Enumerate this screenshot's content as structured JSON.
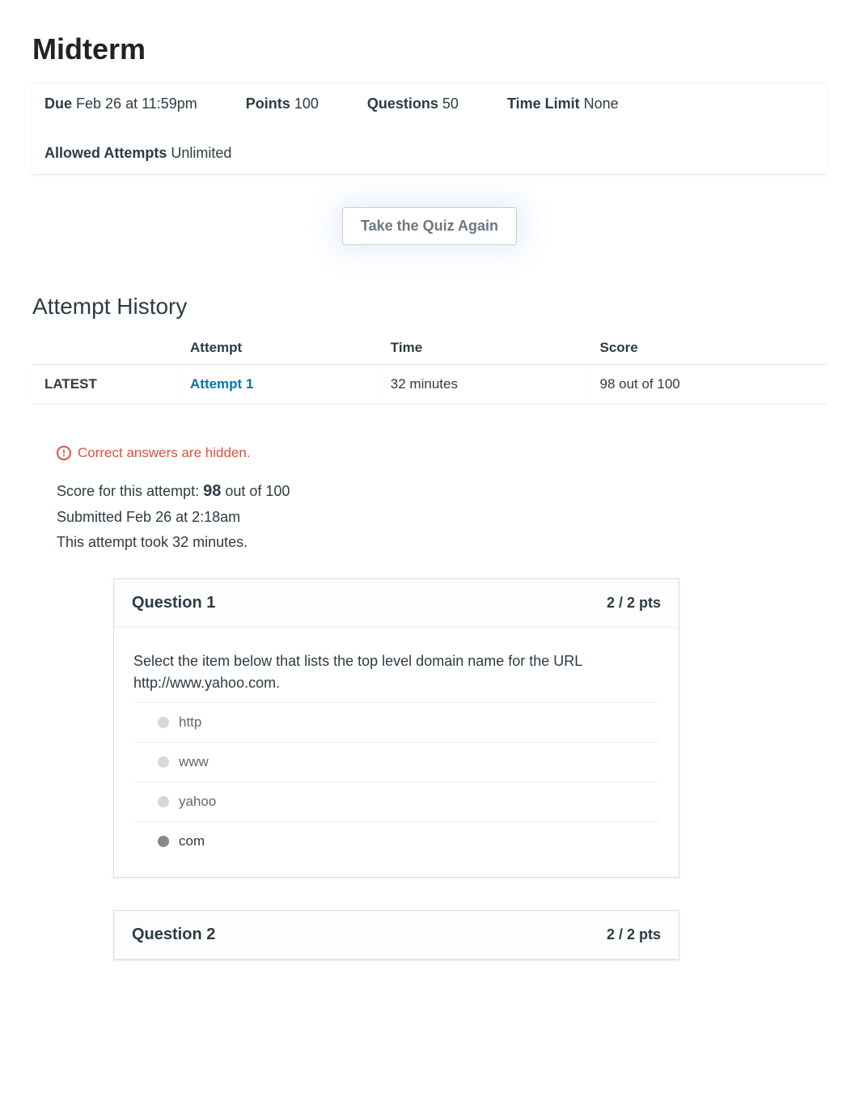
{
  "title": "Midterm",
  "meta": {
    "due_label": "Due",
    "due_value": "Feb 26 at 11:59pm",
    "points_label": "Points",
    "points_value": "100",
    "questions_label": "Questions",
    "questions_value": "50",
    "timelimit_label": "Time Limit",
    "timelimit_value": "None",
    "attempts_label": "Allowed Attempts",
    "attempts_value": "Unlimited"
  },
  "take_again": "Take the Quiz Again",
  "history_heading": "Attempt History",
  "history": {
    "col_blank": "",
    "col_attempt": "Attempt",
    "col_time": "Time",
    "col_score": "Score",
    "rows": [
      {
        "tag": "LATEST",
        "attempt": "Attempt 1",
        "time": "32 minutes",
        "score": "98 out of 100"
      }
    ]
  },
  "hidden_note": "Correct answers are hidden.",
  "score_info": {
    "line1_prefix": "Score for this attempt: ",
    "line1_score": "98",
    "line1_suffix": " out of 100",
    "line2": "Submitted Feb 26 at 2:18am",
    "line3": "This attempt took 32 minutes."
  },
  "questions": [
    {
      "title": "Question 1",
      "pts": "2 / 2 pts",
      "prompt": "Select the item below that lists the top level domain name for the URL http://www.yahoo.com.",
      "answers": [
        {
          "text": "http",
          "selected": false
        },
        {
          "text": "www",
          "selected": false
        },
        {
          "text": "yahoo",
          "selected": false
        },
        {
          "text": "com",
          "selected": true
        }
      ]
    },
    {
      "title": "Question 2",
      "pts": "2 / 2 pts",
      "prompt": "",
      "answers": []
    }
  ]
}
